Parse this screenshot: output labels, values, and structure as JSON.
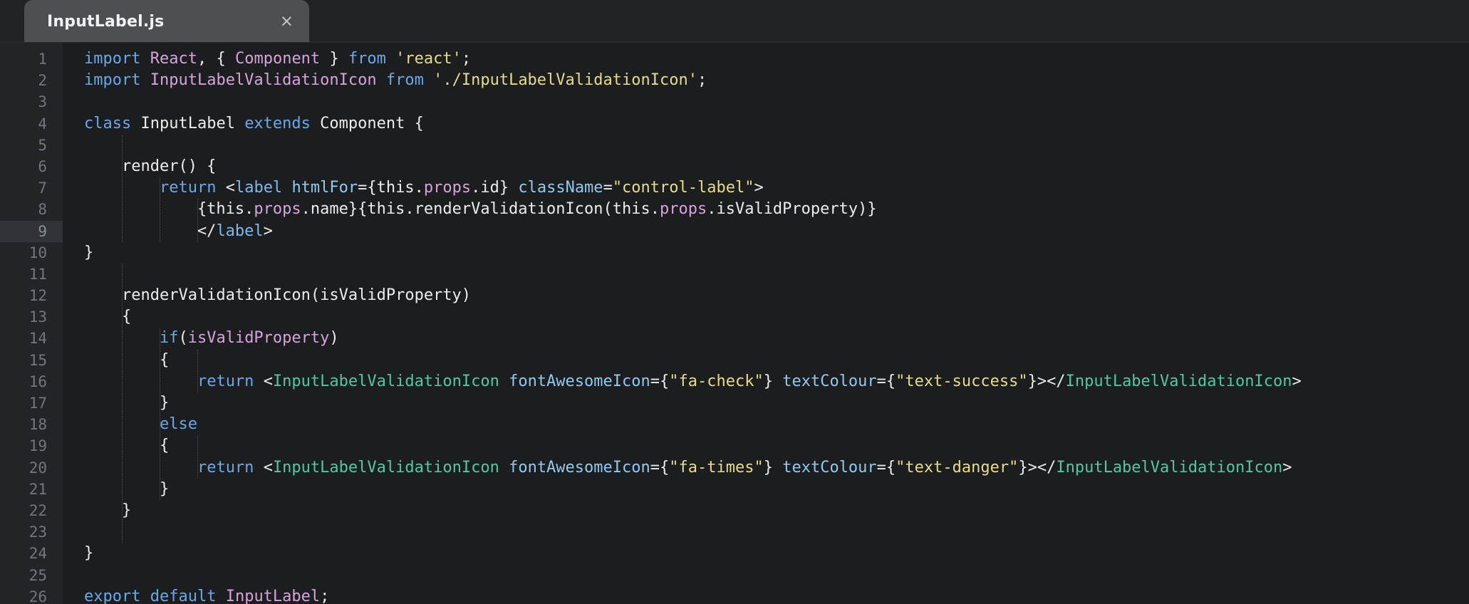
{
  "window": {
    "app": "code-editor",
    "background": "#1c1d1f"
  },
  "tabbar": {
    "active_tab": {
      "label": "InputLabel.js",
      "close_glyph": "×"
    }
  },
  "editor": {
    "language": "javascript",
    "active_line": 9,
    "total_lines": 26,
    "colors": {
      "editor_background": "#1c1d1f",
      "gutter_background": "#232427",
      "tab_background": "#4e4f52",
      "tabbar_background": "#222325",
      "active_line_gutter": "#303338",
      "line_number": "#72777d",
      "keyword": "#6aa9e8",
      "identifier": "#d6a3dd",
      "string": "#e6dc8a",
      "punctuation": "#ececec",
      "jsx_tag": "#7fb9ec",
      "jsx_attribute": "#90c9f2",
      "component": "#4fc9a2"
    },
    "line_numbers": [
      1,
      2,
      3,
      4,
      5,
      6,
      7,
      8,
      9,
      10,
      11,
      12,
      13,
      14,
      15,
      16,
      17,
      18,
      19,
      20,
      21,
      22,
      23,
      24,
      25,
      26
    ],
    "plain_text": [
      "import React, { Component } from 'react';",
      "import InputLabelValidationIcon from './InputLabelValidationIcon';",
      "",
      "class InputLabel extends Component {",
      "",
      "    render() {",
      "        return <label htmlFor={this.props.id} className=\"control-label\">",
      "            {this.props.name}{this.renderValidationIcon(this.props.isValidProperty)}",
      "            </label>",
      "}",
      "",
      "    renderValidationIcon(isValidProperty)",
      "    {",
      "        if(isValidProperty)",
      "        {",
      "            return <InputLabelValidationIcon fontAwesomeIcon={\"fa-check\"} textColour={\"text-success\"}></InputLabelValidationIcon>",
      "        }",
      "        else",
      "        {",
      "            return <InputLabelValidationIcon fontAwesomeIcon={\"fa-times\"} textColour={\"text-danger\"}></InputLabelValidationIcon>",
      "        }",
      "    }",
      "",
      "}",
      "",
      "export default InputLabel;"
    ],
    "lines": [
      {
        "n": 1,
        "indent": 0,
        "tokens": [
          {
            "t": "import",
            "c": "kw"
          },
          {
            "t": " ",
            "c": "plain"
          },
          {
            "t": "React",
            "c": "id"
          },
          {
            "t": ",",
            "c": "pun"
          },
          {
            "t": " ",
            "c": "plain"
          },
          {
            "t": "{",
            "c": "pun"
          },
          {
            "t": " ",
            "c": "plain"
          },
          {
            "t": "Component",
            "c": "id"
          },
          {
            "t": " ",
            "c": "plain"
          },
          {
            "t": "}",
            "c": "pun"
          },
          {
            "t": " ",
            "c": "plain"
          },
          {
            "t": "from",
            "c": "kw"
          },
          {
            "t": " ",
            "c": "plain"
          },
          {
            "t": "'react'",
            "c": "str"
          },
          {
            "t": ";",
            "c": "pun"
          }
        ]
      },
      {
        "n": 2,
        "indent": 0,
        "tokens": [
          {
            "t": "import",
            "c": "kw"
          },
          {
            "t": " ",
            "c": "plain"
          },
          {
            "t": "InputLabelValidationIcon",
            "c": "id"
          },
          {
            "t": " ",
            "c": "plain"
          },
          {
            "t": "from",
            "c": "kw"
          },
          {
            "t": " ",
            "c": "plain"
          },
          {
            "t": "'./InputLabelValidationIcon'",
            "c": "str"
          },
          {
            "t": ";",
            "c": "pun"
          }
        ]
      },
      {
        "n": 3,
        "indent": 0,
        "tokens": []
      },
      {
        "n": 4,
        "indent": 0,
        "tokens": [
          {
            "t": "class",
            "c": "kw"
          },
          {
            "t": " ",
            "c": "plain"
          },
          {
            "t": "InputLabel",
            "c": "pun"
          },
          {
            "t": " ",
            "c": "plain"
          },
          {
            "t": "extends",
            "c": "kw"
          },
          {
            "t": " ",
            "c": "plain"
          },
          {
            "t": "Component",
            "c": "pun"
          },
          {
            "t": " ",
            "c": "plain"
          },
          {
            "t": "{",
            "c": "pun"
          }
        ]
      },
      {
        "n": 5,
        "indent": 0,
        "tokens": []
      },
      {
        "n": 6,
        "indent": 1,
        "tokens": [
          {
            "t": "    render() {",
            "c": "pun"
          }
        ]
      },
      {
        "n": 7,
        "indent": 2,
        "tokens": [
          {
            "t": "        ",
            "c": "plain"
          },
          {
            "t": "return",
            "c": "kw"
          },
          {
            "t": " ",
            "c": "plain"
          },
          {
            "t": "<",
            "c": "pun"
          },
          {
            "t": "label",
            "c": "tag"
          },
          {
            "t": " ",
            "c": "plain"
          },
          {
            "t": "htmlFor",
            "c": "attr"
          },
          {
            "t": "={this.",
            "c": "pun"
          },
          {
            "t": "props",
            "c": "id"
          },
          {
            "t": ".id} ",
            "c": "pun"
          },
          {
            "t": "className",
            "c": "attr"
          },
          {
            "t": "=",
            "c": "pun"
          },
          {
            "t": "\"control-label\"",
            "c": "str"
          },
          {
            "t": ">",
            "c": "pun"
          }
        ]
      },
      {
        "n": 8,
        "indent": 3,
        "tokens": [
          {
            "t": "            {this.",
            "c": "pun"
          },
          {
            "t": "props",
            "c": "id"
          },
          {
            "t": ".name}{this.renderValidationIcon(this.",
            "c": "pun"
          },
          {
            "t": "props",
            "c": "id"
          },
          {
            "t": ".isValidProperty)}",
            "c": "pun"
          }
        ]
      },
      {
        "n": 9,
        "indent": 3,
        "active": true,
        "tokens": [
          {
            "t": "            </",
            "c": "pun"
          },
          {
            "t": "label",
            "c": "tag"
          },
          {
            "t": ">",
            "c": "pun"
          }
        ]
      },
      {
        "n": 10,
        "indent": 0,
        "tokens": [
          {
            "t": "}",
            "c": "pun"
          }
        ]
      },
      {
        "n": 11,
        "indent": 0,
        "tokens": []
      },
      {
        "n": 12,
        "indent": 1,
        "tokens": [
          {
            "t": "    renderValidationIcon(isValidProperty)",
            "c": "pun"
          }
        ]
      },
      {
        "n": 13,
        "indent": 1,
        "tokens": [
          {
            "t": "    {",
            "c": "pun"
          }
        ]
      },
      {
        "n": 14,
        "indent": 2,
        "tokens": [
          {
            "t": "        ",
            "c": "plain"
          },
          {
            "t": "if",
            "c": "kw"
          },
          {
            "t": "(",
            "c": "pun"
          },
          {
            "t": "isValidProperty",
            "c": "id"
          },
          {
            "t": ")",
            "c": "pun"
          }
        ]
      },
      {
        "n": 15,
        "indent": 2,
        "tokens": [
          {
            "t": "        {",
            "c": "pun"
          }
        ]
      },
      {
        "n": 16,
        "indent": 3,
        "tokens": [
          {
            "t": "            ",
            "c": "plain"
          },
          {
            "t": "return",
            "c": "kw"
          },
          {
            "t": " ",
            "c": "plain"
          },
          {
            "t": "<",
            "c": "pun"
          },
          {
            "t": "InputLabelValidationIcon",
            "c": "comp"
          },
          {
            "t": " ",
            "c": "plain"
          },
          {
            "t": "fontAwesomeIcon",
            "c": "attr"
          },
          {
            "t": "={",
            "c": "pun"
          },
          {
            "t": "\"fa-check\"",
            "c": "str"
          },
          {
            "t": "} ",
            "c": "pun"
          },
          {
            "t": "textColour",
            "c": "attr"
          },
          {
            "t": "={",
            "c": "pun"
          },
          {
            "t": "\"text-success\"",
            "c": "str"
          },
          {
            "t": "}></",
            "c": "pun"
          },
          {
            "t": "InputLabelValidationIcon",
            "c": "comp"
          },
          {
            "t": ">",
            "c": "pun"
          }
        ]
      },
      {
        "n": 17,
        "indent": 2,
        "tokens": [
          {
            "t": "        }",
            "c": "pun"
          }
        ]
      },
      {
        "n": 18,
        "indent": 2,
        "tokens": [
          {
            "t": "        ",
            "c": "plain"
          },
          {
            "t": "else",
            "c": "kw"
          }
        ]
      },
      {
        "n": 19,
        "indent": 2,
        "tokens": [
          {
            "t": "        {",
            "c": "pun"
          }
        ]
      },
      {
        "n": 20,
        "indent": 3,
        "tokens": [
          {
            "t": "            ",
            "c": "plain"
          },
          {
            "t": "return",
            "c": "kw"
          },
          {
            "t": " ",
            "c": "plain"
          },
          {
            "t": "<",
            "c": "pun"
          },
          {
            "t": "InputLabelValidationIcon",
            "c": "comp"
          },
          {
            "t": " ",
            "c": "plain"
          },
          {
            "t": "fontAwesomeIcon",
            "c": "attr"
          },
          {
            "t": "={",
            "c": "pun"
          },
          {
            "t": "\"fa-times\"",
            "c": "str"
          },
          {
            "t": "} ",
            "c": "pun"
          },
          {
            "t": "textColour",
            "c": "attr"
          },
          {
            "t": "={",
            "c": "pun"
          },
          {
            "t": "\"text-danger\"",
            "c": "str"
          },
          {
            "t": "}></",
            "c": "pun"
          },
          {
            "t": "InputLabelValidationIcon",
            "c": "comp"
          },
          {
            "t": ">",
            "c": "pun"
          }
        ]
      },
      {
        "n": 21,
        "indent": 2,
        "tokens": [
          {
            "t": "        }",
            "c": "pun"
          }
        ]
      },
      {
        "n": 22,
        "indent": 1,
        "tokens": [
          {
            "t": "    }",
            "c": "pun"
          }
        ]
      },
      {
        "n": 23,
        "indent": 0,
        "tokens": []
      },
      {
        "n": 24,
        "indent": 0,
        "tokens": [
          {
            "t": "}",
            "c": "pun"
          }
        ]
      },
      {
        "n": 25,
        "indent": 0,
        "tokens": []
      },
      {
        "n": 26,
        "indent": 0,
        "tokens": [
          {
            "t": "export",
            "c": "kw"
          },
          {
            "t": " ",
            "c": "plain"
          },
          {
            "t": "default",
            "c": "kw"
          },
          {
            "t": " ",
            "c": "plain"
          },
          {
            "t": "InputLabel",
            "c": "id"
          },
          {
            "t": ";",
            "c": "pun"
          }
        ]
      }
    ],
    "indent_guides": [
      {
        "col": 1,
        "from_line": 5,
        "to_line": 9
      },
      {
        "col": 2,
        "from_line": 7,
        "to_line": 9
      },
      {
        "col": 3,
        "from_line": 8,
        "to_line": 9
      },
      {
        "col": 1,
        "from_line": 11,
        "to_line": 23
      },
      {
        "col": 2,
        "from_line": 14,
        "to_line": 21
      },
      {
        "col": 3,
        "from_line": 15,
        "to_line": 16
      },
      {
        "col": 3,
        "from_line": 19,
        "to_line": 20
      }
    ]
  }
}
